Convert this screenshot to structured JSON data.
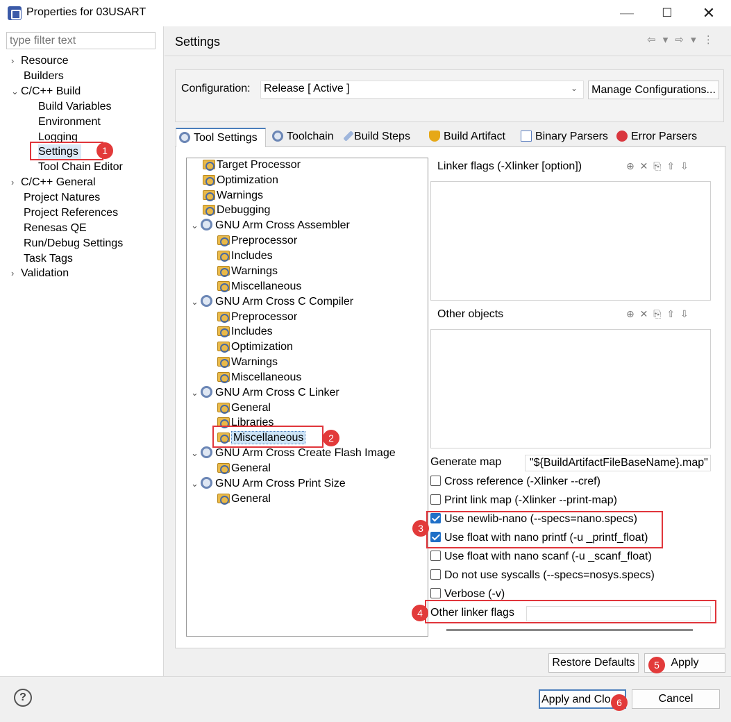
{
  "window": {
    "title": "Properties for 03USART",
    "minimize": "—",
    "maximize": "☐",
    "close": "✕"
  },
  "sidebar": {
    "filter_placeholder": "type filter text",
    "items": [
      {
        "label": "Resource",
        "expander": "›"
      },
      {
        "label": "Builders"
      },
      {
        "label": "C/C++ Build",
        "expander": "⌄"
      },
      {
        "label": "Build Variables"
      },
      {
        "label": "Environment"
      },
      {
        "label": "Logging"
      },
      {
        "label": "Settings"
      },
      {
        "label": "Tool Chain Editor"
      },
      {
        "label": "C/C++ General",
        "expander": "›"
      },
      {
        "label": "Project Natures"
      },
      {
        "label": "Project References"
      },
      {
        "label": "Renesas QE"
      },
      {
        "label": "Run/Debug Settings"
      },
      {
        "label": "Task Tags"
      },
      {
        "label": "Validation",
        "expander": "›"
      }
    ]
  },
  "header": {
    "title": "Settings",
    "nav_arrows": "⇦ ▾ ⇨ ▾ ⋮"
  },
  "configuration": {
    "label": "Configuration:",
    "value": "Release  [ Active ]",
    "chevron": "⌄",
    "manage_label": "Manage Configurations..."
  },
  "tabs": [
    {
      "label": "Tool Settings",
      "icon": "gear-icon",
      "color": "#6b86b5"
    },
    {
      "label": "Toolchain",
      "icon": "gear-icon",
      "color": "#6b86b5"
    },
    {
      "label": "Build Steps",
      "icon": "wand-icon",
      "color": "#7a9ad0"
    },
    {
      "label": "Build Artifact",
      "icon": "trophy-icon",
      "color": "#e6a817"
    },
    {
      "label": "Binary Parsers",
      "icon": "binary-icon",
      "color": "#5a7dbf"
    },
    {
      "label": "Error Parsers",
      "icon": "error-icon",
      "color": "#d9363e"
    }
  ],
  "tool_tree": [
    {
      "label": "Target Processor",
      "level": 0,
      "type": "folder"
    },
    {
      "label": "Optimization",
      "level": 0,
      "type": "folder"
    },
    {
      "label": "Warnings",
      "level": 0,
      "type": "folder"
    },
    {
      "label": "Debugging",
      "level": 0,
      "type": "folder"
    },
    {
      "label": "GNU Arm Cross Assembler",
      "level": 0,
      "type": "tool",
      "expander": "⌄"
    },
    {
      "label": "Preprocessor",
      "level": 1,
      "type": "folder"
    },
    {
      "label": "Includes",
      "level": 1,
      "type": "folder"
    },
    {
      "label": "Warnings",
      "level": 1,
      "type": "folder"
    },
    {
      "label": "Miscellaneous",
      "level": 1,
      "type": "folder"
    },
    {
      "label": "GNU Arm Cross C Compiler",
      "level": 0,
      "type": "tool",
      "expander": "⌄"
    },
    {
      "label": "Preprocessor",
      "level": 1,
      "type": "folder"
    },
    {
      "label": "Includes",
      "level": 1,
      "type": "folder"
    },
    {
      "label": "Optimization",
      "level": 1,
      "type": "folder"
    },
    {
      "label": "Warnings",
      "level": 1,
      "type": "folder"
    },
    {
      "label": "Miscellaneous",
      "level": 1,
      "type": "folder"
    },
    {
      "label": "GNU Arm Cross C Linker",
      "level": 0,
      "type": "tool",
      "expander": "⌄"
    },
    {
      "label": "General",
      "level": 1,
      "type": "folder"
    },
    {
      "label": "Libraries",
      "level": 1,
      "type": "folder"
    },
    {
      "label": "Miscellaneous",
      "level": 1,
      "type": "folder",
      "selected": true
    },
    {
      "label": "GNU Arm Cross Create Flash Image",
      "level": 0,
      "type": "tool",
      "expander": "⌄"
    },
    {
      "label": "General",
      "level": 1,
      "type": "folder"
    },
    {
      "label": "GNU Arm Cross Print Size",
      "level": 0,
      "type": "tool",
      "expander": "⌄"
    },
    {
      "label": "General",
      "level": 1,
      "type": "folder"
    }
  ],
  "linker_flags": {
    "label": "Linker flags (-Xlinker [option])",
    "tools": "⊕ ✕ ⎘ ⇧ ⇩"
  },
  "other_objects": {
    "label": "Other objects",
    "tools": "⊕ ✕ ⎘ ⇧ ⇩"
  },
  "generate_map": {
    "label": "Generate map",
    "value": "\"${BuildArtifactFileBaseName}.map\""
  },
  "options": [
    {
      "label": "Cross reference (-Xlinker --cref)",
      "checked": false
    },
    {
      "label": "Print link map (-Xlinker --print-map)",
      "checked": false
    },
    {
      "label": "Use newlib-nano (--specs=nano.specs)",
      "checked": true
    },
    {
      "label": "Use float with nano printf (-u _printf_float)",
      "checked": true
    },
    {
      "label": "Use float with nano scanf (-u _scanf_float)",
      "checked": false
    },
    {
      "label": "Do not use syscalls (--specs=nosys.specs)",
      "checked": false
    },
    {
      "label": "Verbose (-v)",
      "checked": false
    }
  ],
  "other_linker_flags": {
    "label": "Other linker flags",
    "value": ""
  },
  "buttons": {
    "restore_defaults": "Restore Defaults",
    "apply": "Apply",
    "apply_and_close": "Apply and Clo",
    "cancel": "Cancel",
    "help": "?"
  },
  "annotations": {
    "markers": [
      "1",
      "2",
      "3",
      "4",
      "5",
      "6"
    ],
    "color": "#e0353b"
  }
}
